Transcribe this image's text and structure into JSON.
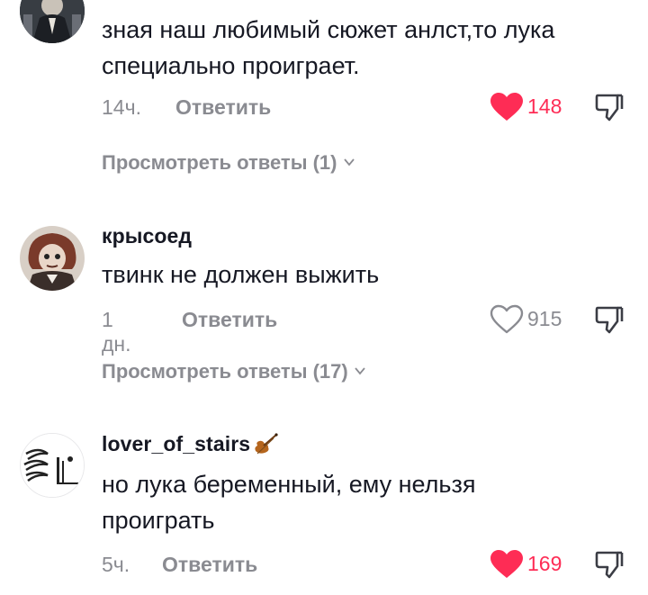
{
  "comments": [
    {
      "username": "",
      "text_line1": "зная наш любимый сюжет анлст,то лука",
      "text_line2": "специально проиграет.",
      "time": "14ч.",
      "reply_label": "Ответить",
      "likes": "148",
      "liked": true,
      "view_replies": "Просмотреть ответы (1)"
    },
    {
      "username": "крысоед",
      "text_line1": "твинк не должен выжить",
      "time": "1 дн.",
      "reply_label": "Ответить",
      "likes": "915",
      "liked": false,
      "view_replies": "Просмотреть ответы (17)"
    },
    {
      "username": "lover_of_stairs",
      "username_emoji": "violin-emoji",
      "text_line1": "но лука беременный, ему нельзя",
      "text_line2": "проиграть",
      "time": "5ч.",
      "reply_label": "Ответить",
      "likes": "169",
      "liked": true
    }
  ],
  "colors": {
    "accent": "#fe2c55",
    "muted": "#8a8b91",
    "text": "#161823"
  },
  "icons": [
    "heart-filled-icon",
    "heart-outline-icon",
    "dislike-icon",
    "chevron-down-icon"
  ]
}
